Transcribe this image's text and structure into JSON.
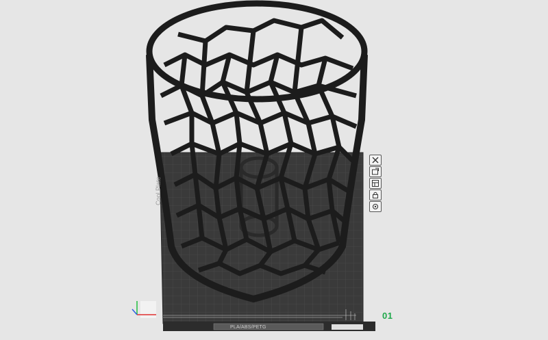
{
  "viewport": {
    "background": "#e6e6e6",
    "plate_color": "#3a3a3a",
    "grid_color": "#4a4a4a",
    "model_color": "#1c1c1c"
  },
  "plate": {
    "number": "01",
    "number_color": "#1fa84a",
    "footer_label": "PLA/ABS/PETG",
    "side_label": "Cool Plate"
  },
  "plate_tools": [
    {
      "name": "close-icon",
      "title": "Remove plate"
    },
    {
      "name": "auto-orient-icon",
      "title": "Auto orient"
    },
    {
      "name": "arrange-icon",
      "title": "Arrange"
    },
    {
      "name": "lock-icon",
      "title": "Lock plate"
    },
    {
      "name": "settings-icon",
      "title": "Plate settings"
    }
  ]
}
